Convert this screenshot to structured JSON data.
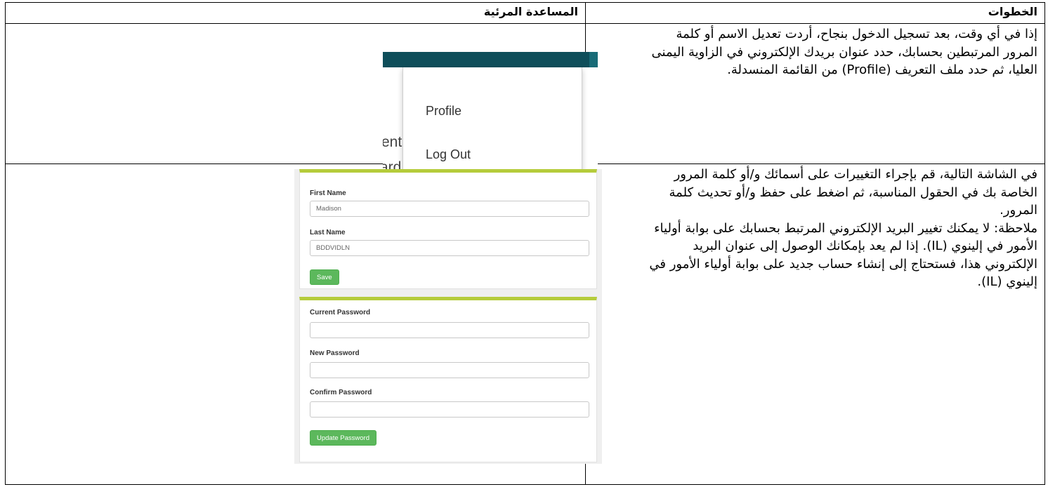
{
  "table": {
    "header_steps": "الخطوات",
    "header_visual": "المساعدة المرئية"
  },
  "row1": {
    "text": "إذا في أي وقت، بعد تسجيل الدخول بنجاح، أردت تعديل الاسم أو كلمة المرور المرتبطين بحسابك، حدد عنوان بريدك الإلكتروني في الزاوية اليمنى العليا، ثم حدد ملف التعريف (Profile) من القائمة المنسدلة."
  },
  "row2": {
    "text": "في الشاشة التالية، قم بإجراء التغييرات على أسمائك و/أو كلمة المرور الخاصة بك في الحقول المناسبة، ثم اضغط على حفظ و/أو تحديث كلمة المرور.",
    "note": "ملاحظة: لا يمكنك تغيير البريد الإلكتروني المرتبط بحسابك على بوابة أولياء الأمور في إلينوي (IL). إذا لم يعد بإمكانك الوصول إلى عنوان البريد الإلكتروني هذا، فستحتاج إلى إنشاء حساب جديد على بوابة أولياء الأمور في إلينوي (IL)."
  },
  "screenshot_menu": {
    "bg_text_1": "ent",
    "bg_text_2": "ard or media.",
    "items": [
      "Profile",
      "Log Out"
    ],
    "colors": {
      "bar": "#0e4e5a"
    }
  },
  "screenshot_form": {
    "first_name_label": "First Name",
    "first_name_value": "Madison",
    "last_name_label": "Last Name",
    "last_name_value": "BDDVIDLN",
    "save_button": "Save",
    "current_password_label": "Current Password",
    "new_password_label": "New Password",
    "confirm_password_label": "Confirm Password",
    "update_password_button": "Update Password",
    "colors": {
      "accent_border": "#b5cc3b",
      "button": "#5cb85c"
    }
  }
}
